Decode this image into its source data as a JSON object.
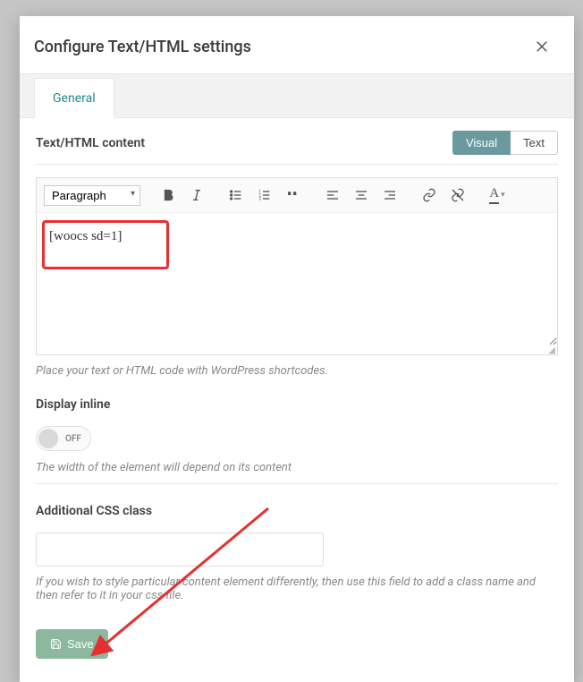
{
  "modal": {
    "title": "Configure Text/HTML settings",
    "tabs": [
      {
        "label": "General"
      }
    ]
  },
  "content": {
    "label": "Text/HTML content",
    "toggles": {
      "visual": "Visual",
      "text": "Text"
    },
    "format_selected": "Paragraph",
    "editor_text": "[woocs sd=1]",
    "help": "Place your text or HTML code with WordPress shortcodes."
  },
  "display_inline": {
    "title": "Display inline",
    "state_label": "OFF",
    "help": "The width of the element will depend on its content"
  },
  "css_class": {
    "title": "Additional CSS class",
    "value": "",
    "help": "If you wish to style particular content element differently, then use this field to add a class name and then refer to it in your css file."
  },
  "actions": {
    "save": "Save"
  },
  "icons": {
    "bold": "bold-icon",
    "italic": "italic-icon",
    "ul": "bullet-list-icon",
    "ol": "numbered-list-icon",
    "quote": "blockquote-icon",
    "align_left": "align-left-icon",
    "align_center": "align-center-icon",
    "align_right": "align-right-icon",
    "link": "link-icon",
    "unlink": "unlink-icon",
    "textcolor": "text-color-icon"
  }
}
